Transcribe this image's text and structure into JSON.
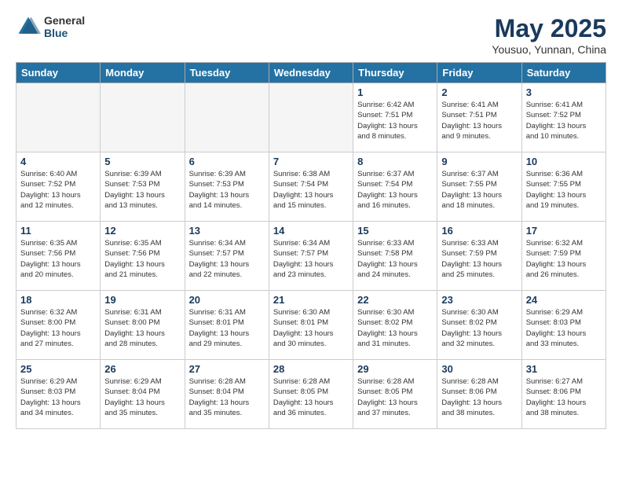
{
  "header": {
    "logo_general": "General",
    "logo_blue": "Blue",
    "month_title": "May 2025",
    "location": "Yousuo, Yunnan, China"
  },
  "days_of_week": [
    "Sunday",
    "Monday",
    "Tuesday",
    "Wednesday",
    "Thursday",
    "Friday",
    "Saturday"
  ],
  "weeks": [
    [
      {
        "day": null,
        "info": ""
      },
      {
        "day": null,
        "info": ""
      },
      {
        "day": null,
        "info": ""
      },
      {
        "day": null,
        "info": ""
      },
      {
        "day": "1",
        "info": "Sunrise: 6:42 AM\nSunset: 7:51 PM\nDaylight: 13 hours\nand 8 minutes."
      },
      {
        "day": "2",
        "info": "Sunrise: 6:41 AM\nSunset: 7:51 PM\nDaylight: 13 hours\nand 9 minutes."
      },
      {
        "day": "3",
        "info": "Sunrise: 6:41 AM\nSunset: 7:52 PM\nDaylight: 13 hours\nand 10 minutes."
      }
    ],
    [
      {
        "day": "4",
        "info": "Sunrise: 6:40 AM\nSunset: 7:52 PM\nDaylight: 13 hours\nand 12 minutes."
      },
      {
        "day": "5",
        "info": "Sunrise: 6:39 AM\nSunset: 7:53 PM\nDaylight: 13 hours\nand 13 minutes."
      },
      {
        "day": "6",
        "info": "Sunrise: 6:39 AM\nSunset: 7:53 PM\nDaylight: 13 hours\nand 14 minutes."
      },
      {
        "day": "7",
        "info": "Sunrise: 6:38 AM\nSunset: 7:54 PM\nDaylight: 13 hours\nand 15 minutes."
      },
      {
        "day": "8",
        "info": "Sunrise: 6:37 AM\nSunset: 7:54 PM\nDaylight: 13 hours\nand 16 minutes."
      },
      {
        "day": "9",
        "info": "Sunrise: 6:37 AM\nSunset: 7:55 PM\nDaylight: 13 hours\nand 18 minutes."
      },
      {
        "day": "10",
        "info": "Sunrise: 6:36 AM\nSunset: 7:55 PM\nDaylight: 13 hours\nand 19 minutes."
      }
    ],
    [
      {
        "day": "11",
        "info": "Sunrise: 6:35 AM\nSunset: 7:56 PM\nDaylight: 13 hours\nand 20 minutes."
      },
      {
        "day": "12",
        "info": "Sunrise: 6:35 AM\nSunset: 7:56 PM\nDaylight: 13 hours\nand 21 minutes."
      },
      {
        "day": "13",
        "info": "Sunrise: 6:34 AM\nSunset: 7:57 PM\nDaylight: 13 hours\nand 22 minutes."
      },
      {
        "day": "14",
        "info": "Sunrise: 6:34 AM\nSunset: 7:57 PM\nDaylight: 13 hours\nand 23 minutes."
      },
      {
        "day": "15",
        "info": "Sunrise: 6:33 AM\nSunset: 7:58 PM\nDaylight: 13 hours\nand 24 minutes."
      },
      {
        "day": "16",
        "info": "Sunrise: 6:33 AM\nSunset: 7:59 PM\nDaylight: 13 hours\nand 25 minutes."
      },
      {
        "day": "17",
        "info": "Sunrise: 6:32 AM\nSunset: 7:59 PM\nDaylight: 13 hours\nand 26 minutes."
      }
    ],
    [
      {
        "day": "18",
        "info": "Sunrise: 6:32 AM\nSunset: 8:00 PM\nDaylight: 13 hours\nand 27 minutes."
      },
      {
        "day": "19",
        "info": "Sunrise: 6:31 AM\nSunset: 8:00 PM\nDaylight: 13 hours\nand 28 minutes."
      },
      {
        "day": "20",
        "info": "Sunrise: 6:31 AM\nSunset: 8:01 PM\nDaylight: 13 hours\nand 29 minutes."
      },
      {
        "day": "21",
        "info": "Sunrise: 6:30 AM\nSunset: 8:01 PM\nDaylight: 13 hours\nand 30 minutes."
      },
      {
        "day": "22",
        "info": "Sunrise: 6:30 AM\nSunset: 8:02 PM\nDaylight: 13 hours\nand 31 minutes."
      },
      {
        "day": "23",
        "info": "Sunrise: 6:30 AM\nSunset: 8:02 PM\nDaylight: 13 hours\nand 32 minutes."
      },
      {
        "day": "24",
        "info": "Sunrise: 6:29 AM\nSunset: 8:03 PM\nDaylight: 13 hours\nand 33 minutes."
      }
    ],
    [
      {
        "day": "25",
        "info": "Sunrise: 6:29 AM\nSunset: 8:03 PM\nDaylight: 13 hours\nand 34 minutes."
      },
      {
        "day": "26",
        "info": "Sunrise: 6:29 AM\nSunset: 8:04 PM\nDaylight: 13 hours\nand 35 minutes."
      },
      {
        "day": "27",
        "info": "Sunrise: 6:28 AM\nSunset: 8:04 PM\nDaylight: 13 hours\nand 35 minutes."
      },
      {
        "day": "28",
        "info": "Sunrise: 6:28 AM\nSunset: 8:05 PM\nDaylight: 13 hours\nand 36 minutes."
      },
      {
        "day": "29",
        "info": "Sunrise: 6:28 AM\nSunset: 8:05 PM\nDaylight: 13 hours\nand 37 minutes."
      },
      {
        "day": "30",
        "info": "Sunrise: 6:28 AM\nSunset: 8:06 PM\nDaylight: 13 hours\nand 38 minutes."
      },
      {
        "day": "31",
        "info": "Sunrise: 6:27 AM\nSunset: 8:06 PM\nDaylight: 13 hours\nand 38 minutes."
      }
    ]
  ]
}
